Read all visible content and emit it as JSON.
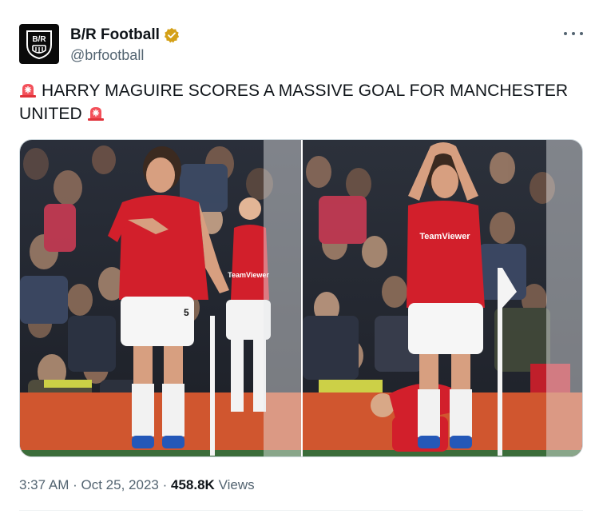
{
  "author": {
    "display_name": "B/R Football",
    "handle": "@brfootball",
    "avatar_text": "B/R"
  },
  "tweet": {
    "text_line1": "HARRY MAGUIRE SCORES A MASSIVE GOAL FOR MANCHESTER",
    "text_line2": "UNITED"
  },
  "shirt_text": {
    "sponsor_left": "TeamViewer",
    "sponsor_right": "TeamViewer",
    "number": "5"
  },
  "meta": {
    "time": "3:37 AM",
    "separator": "·",
    "date": "Oct 25, 2023",
    "views_count": "458.8K",
    "views_label": "Views"
  },
  "colors": {
    "brand_badge": "#d4a017",
    "siren": "#e0323a",
    "kit_red": "#d21f2b",
    "pitch_board": "#d0562f",
    "text_primary": "#0f1419",
    "text_secondary": "#536471"
  },
  "icons": {
    "verified": "gold-check-badge",
    "more": "horizontal-ellipsis",
    "siren": "police-car-light-emoji"
  }
}
